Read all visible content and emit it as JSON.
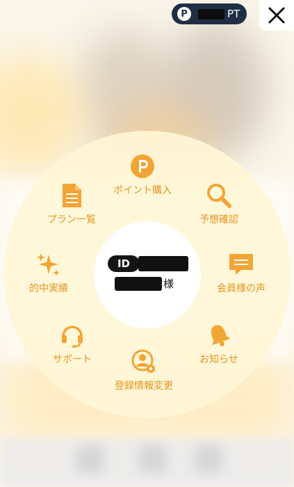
{
  "header": {
    "points_icon_letter": "P",
    "points_unit": "PT",
    "close_icon": "close-icon"
  },
  "profile": {
    "id_label": "ID",
    "honorific": "様"
  },
  "menu": {
    "point_purchase": "ポイント購入",
    "prediction_check": "予想確認",
    "member_voice": "会員様の声",
    "notifications": "お知らせ",
    "registration_change": "登録情報変更",
    "support": "サポート",
    "track_record": "的中実績",
    "plan_list": "プラン一覧"
  },
  "colors": {
    "accent": "#f2a534",
    "label": "#e3951f",
    "pill": "#1f2e45"
  }
}
